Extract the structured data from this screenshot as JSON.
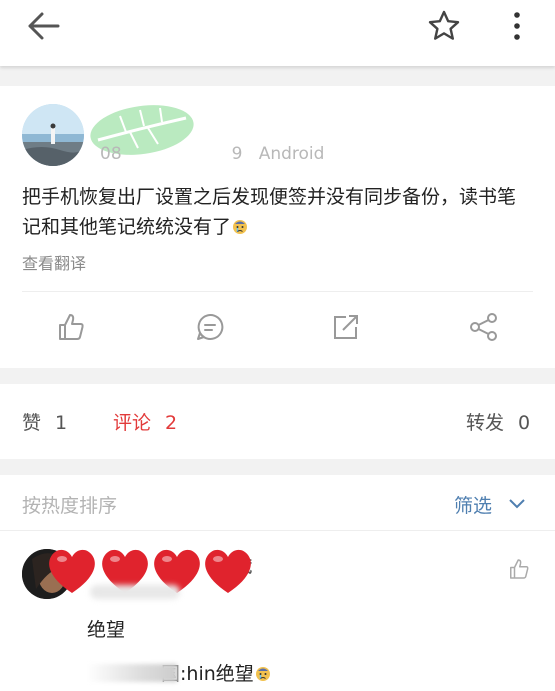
{
  "topbar": {
    "back_icon": "arrow-left-icon",
    "favorite_icon": "star-icon",
    "more_icon": "more-vertical-icon"
  },
  "post": {
    "client": "Android",
    "time_fragment_left": "08",
    "time_fragment_right": "9",
    "text": "把手机恢复出厂设置之后发现便签并没有同步备份，读书笔记和其他笔记统统没有了",
    "text_emoji": "crying-emoji",
    "translate_label": "查看翻译",
    "actions": [
      "like-icon",
      "comment-icon",
      "repost-icon",
      "share-icon"
    ]
  },
  "tabs": {
    "like_label": "赞",
    "like_count": "1",
    "comment_label": "评论",
    "comment_count": "2",
    "repost_label": "转发",
    "repost_count": "0",
    "active_color": "#e23a3a"
  },
  "sort": {
    "label": "按热度排序",
    "filter_label": "筛选",
    "accent": "#4f7fb0"
  },
  "comment": {
    "name_fragment": "藏",
    "text": "绝望",
    "reply_fragment": "国",
    "reply_text": ":hin绝望",
    "reply_emoji": "crying-emoji"
  }
}
